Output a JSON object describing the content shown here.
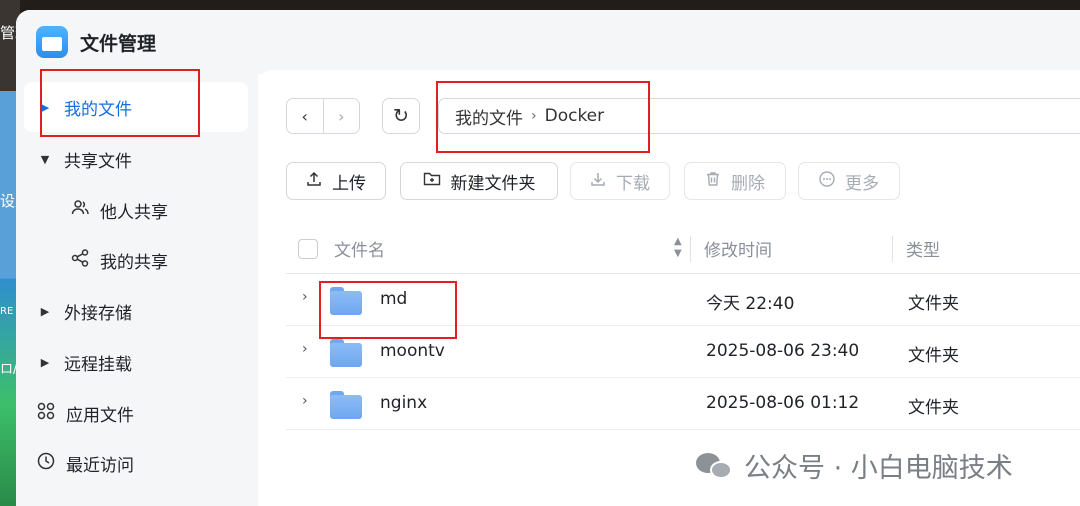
{
  "desktop": {
    "labels": [
      "管理",
      "设置",
      "RE",
      "ロ/"
    ]
  },
  "window": {
    "title": "文件管理"
  },
  "sidebar": {
    "items": [
      {
        "label": "我的文件",
        "active": true,
        "icon": "caret-right-icon"
      },
      {
        "label": "共享文件",
        "icon": "caret-down-icon"
      },
      {
        "label": "他人共享",
        "icon": "users-icon"
      },
      {
        "label": "我的共享",
        "icon": "share-icon"
      },
      {
        "label": "外接存储",
        "icon": "caret-right-icon"
      },
      {
        "label": "远程挂载",
        "icon": "caret-right-icon"
      },
      {
        "label": "应用文件",
        "icon": "apps-grid-icon"
      },
      {
        "label": "最近访问",
        "icon": "clock-icon"
      }
    ]
  },
  "nav": {
    "back": "‹",
    "forward": "›",
    "refresh": "↻"
  },
  "path": {
    "root": "我的文件",
    "separator": "›",
    "current": "Docker"
  },
  "toolbar": {
    "upload": "上传",
    "new_folder": "新建文件夹",
    "download": "下载",
    "delete": "删除",
    "more": "更多"
  },
  "table": {
    "headers": {
      "name": "文件名",
      "modified": "修改时间",
      "type": "类型"
    },
    "rows": [
      {
        "name": "md",
        "modified": "今天 22:40",
        "type": "文件夹"
      },
      {
        "name": "moontv",
        "modified": "2025-08-06 23:40",
        "type": "文件夹"
      },
      {
        "name": "nginx",
        "modified": "2025-08-06 01:12",
        "type": "文件夹"
      }
    ]
  },
  "watermark": {
    "text": "公众号 · 小白电脑技术"
  },
  "colors": {
    "accent": "#1a6de0",
    "annotation": "#e02020",
    "folder": "#6ea7ef"
  }
}
